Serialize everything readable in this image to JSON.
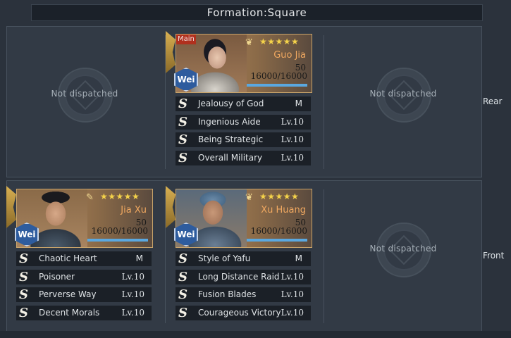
{
  "formation": {
    "title": "Formation:Square"
  },
  "rows": [
    {
      "label": "Rear"
    },
    {
      "label": "Front"
    }
  ],
  "empty_slot_text": "Not dispatched",
  "generals": [
    {
      "id": "guo_jia",
      "name": "Guo Jia",
      "main_tag": "Main",
      "faction": "Wei",
      "stars": "★★★★★",
      "level": "50",
      "troops": "16000/16000",
      "hp_fraction": 1.0,
      "skills": [
        {
          "name": "Jealousy of God",
          "level": "M"
        },
        {
          "name": "Ingenious Aide",
          "level": "Lv.10"
        },
        {
          "name": "Being Strategic",
          "level": "Lv.10"
        },
        {
          "name": "Overall Military",
          "level": "Lv.10"
        }
      ]
    },
    {
      "id": "jia_xu",
      "name": "Jia Xu",
      "faction": "Wei",
      "stars": "★★★★★",
      "level": "50",
      "troops": "16000/16000",
      "hp_fraction": 1.0,
      "skills": [
        {
          "name": "Chaotic Heart",
          "level": "M"
        },
        {
          "name": "Poisoner",
          "level": "Lv.10"
        },
        {
          "name": "Perverse Way",
          "level": "Lv.10"
        },
        {
          "name": "Decent Morals",
          "level": "Lv.10"
        }
      ]
    },
    {
      "id": "xu_huang",
      "name": "Xu Huang",
      "faction": "Wei",
      "stars": "★★★★★",
      "level": "50",
      "troops": "16000/16000",
      "hp_fraction": 1.0,
      "skills": [
        {
          "name": "Style of Yafu",
          "level": "M"
        },
        {
          "name": "Long Distance Raid",
          "level": "Lv.10"
        },
        {
          "name": "Fusion Blades",
          "level": "Lv.10"
        },
        {
          "name": "Courageous Victory",
          "level": "Lv.10"
        }
      ]
    }
  ],
  "skill_icon_glyph": "S",
  "colors": {
    "accent_name": "#f0a860",
    "stars": "#f4d24a",
    "faction_wei": "#2e5c9e",
    "main_tag": "#b0301e"
  }
}
